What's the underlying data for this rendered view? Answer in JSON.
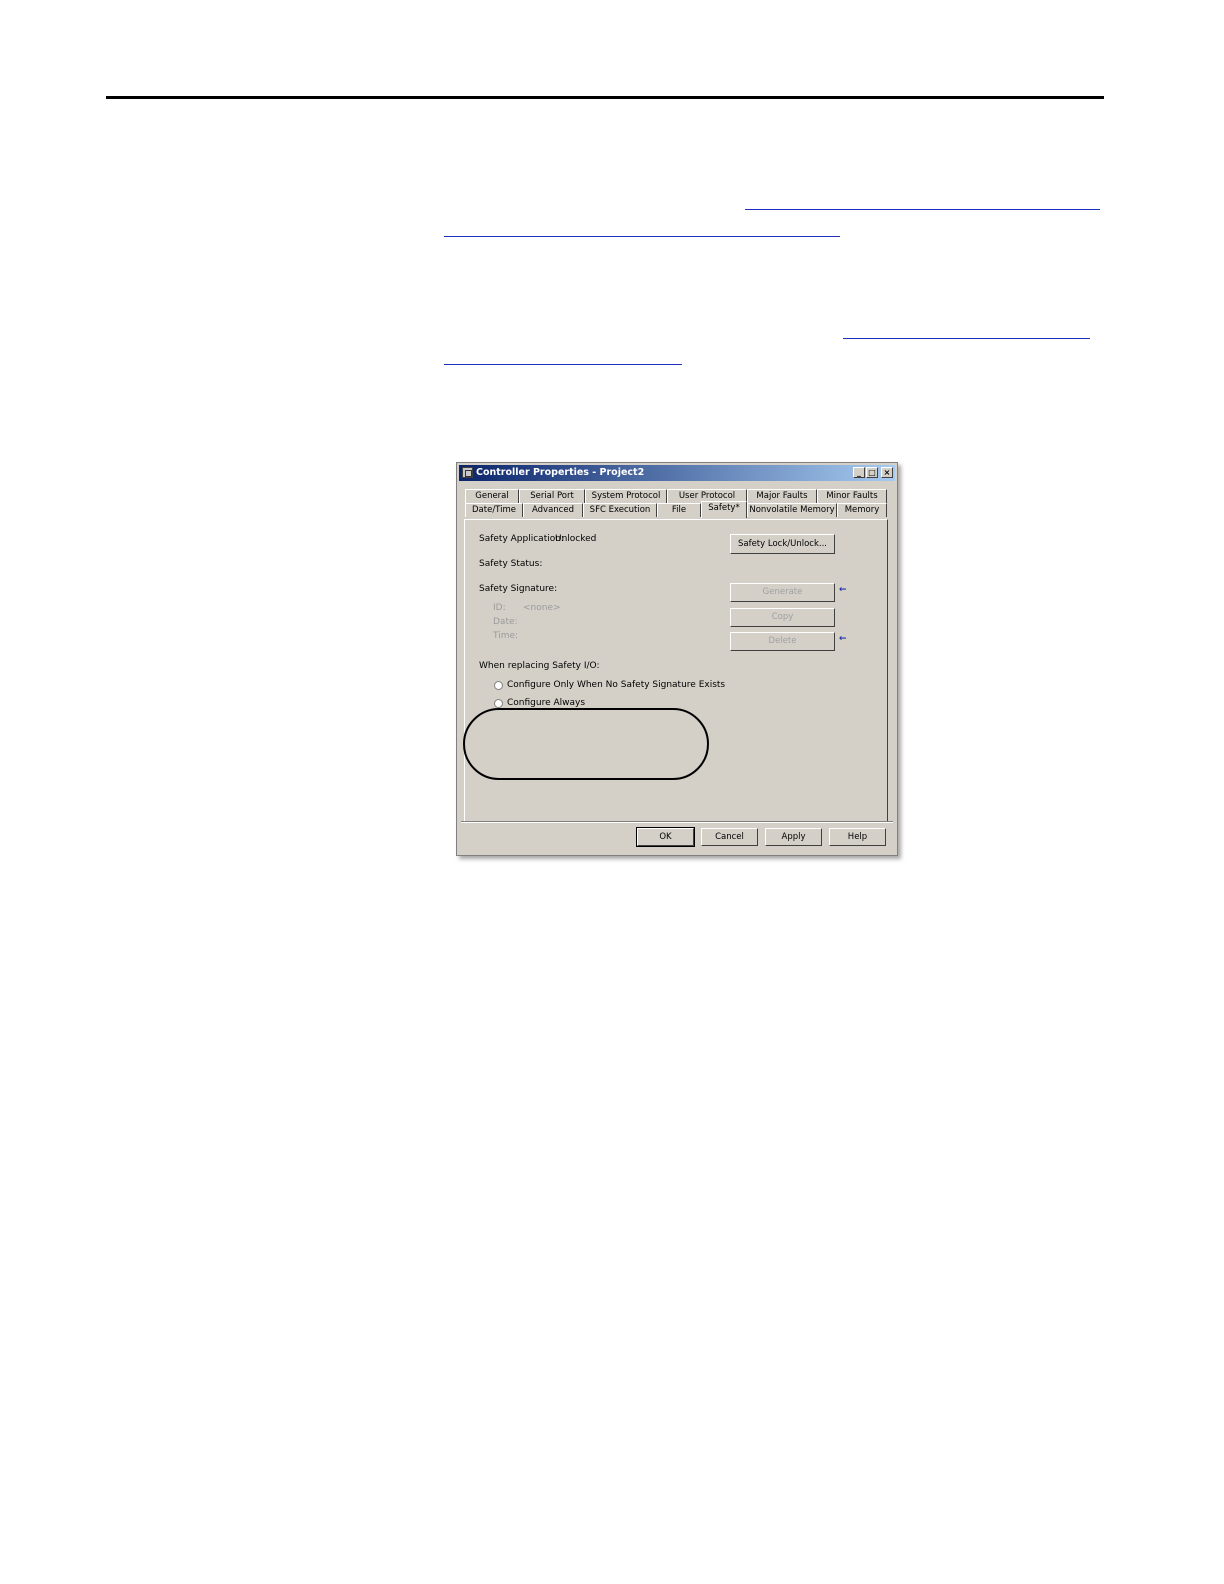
{
  "dialog": {
    "title": "Controller Properties - Project2",
    "window_buttons": {
      "minimize": "_",
      "maximize": "□",
      "close": "×"
    },
    "tabs_row1": [
      "General",
      "Serial Port",
      "System Protocol",
      "User Protocol",
      "Major Faults",
      "Minor Faults"
    ],
    "tabs_row2": [
      "Date/Time",
      "Advanced",
      "SFC Execution",
      "File",
      "Safety*",
      "Nonvolatile Memory",
      "Memory"
    ],
    "active_tab": "Safety*",
    "safety": {
      "application_label": "Safety Application:",
      "application_value": "Unlocked",
      "status_label": "Safety Status:",
      "signature_label": "Safety Signature:",
      "id_label": "ID:",
      "id_value": "<none>",
      "date_label": "Date:",
      "time_label": "Time:",
      "lock_button": "Safety Lock/Unlock...",
      "generate_button": "Generate",
      "copy_button": "Copy",
      "delete_button": "Delete",
      "replacing_label": "When replacing Safety I/O:",
      "option_1": "Configure Only When No Safety Signature Exists",
      "option_2": "Configure Always"
    },
    "footer": {
      "ok": "OK",
      "cancel": "Cancel",
      "apply": "Apply",
      "help": "Help"
    }
  }
}
